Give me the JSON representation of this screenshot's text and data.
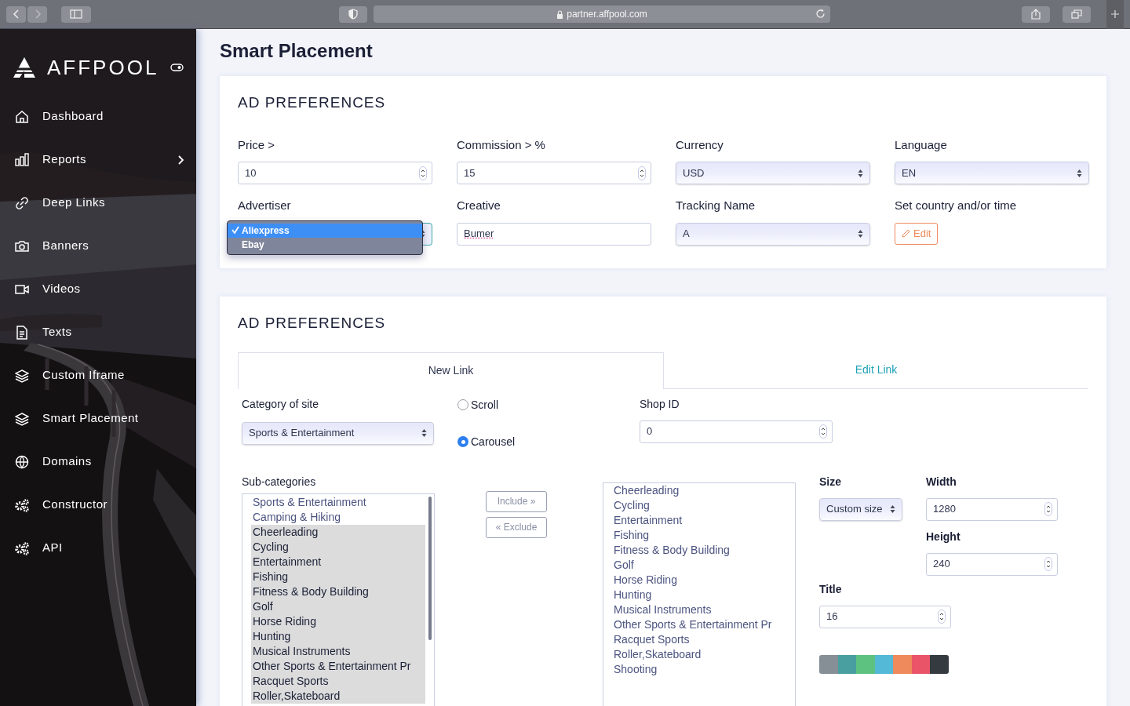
{
  "browser": {
    "url": "partner.affpool.com"
  },
  "sidebar": {
    "logo": "AFFPOOL",
    "items": [
      {
        "label": "Dashboard",
        "expandable": false
      },
      {
        "label": "Reports",
        "expandable": true
      },
      {
        "label": "Deep Links",
        "expandable": false
      },
      {
        "label": "Banners",
        "expandable": false
      },
      {
        "label": "Videos",
        "expandable": false
      },
      {
        "label": "Texts",
        "expandable": false
      },
      {
        "label": "Custom Iframe",
        "expandable": false
      },
      {
        "label": "Smart Placement",
        "expandable": false
      },
      {
        "label": "Domains",
        "expandable": false
      },
      {
        "label": "Constructor",
        "expandable": false
      },
      {
        "label": "API",
        "expandable": false
      }
    ]
  },
  "page_title": "Smart Placement",
  "ad_preferences": {
    "title": "AD PREFERENCES",
    "fields": [
      {
        "label": "Price >",
        "kind": "number",
        "value": "10"
      },
      {
        "label": "Commission > %",
        "kind": "number",
        "value": "15"
      },
      {
        "label": "Currency",
        "kind": "select",
        "value": "USD"
      },
      {
        "label": "Language",
        "kind": "select",
        "value": "EN"
      },
      {
        "label": "Advertiser",
        "kind": "dropdown",
        "options": [
          {
            "label": "Aliexpress",
            "selected": true
          },
          {
            "label": "Ebay",
            "selected": false
          }
        ]
      },
      {
        "label": "Creative",
        "kind": "text",
        "value": "Bumer"
      },
      {
        "label": "Tracking Name",
        "kind": "select",
        "value": "A"
      },
      {
        "label": "Set country and/or time",
        "kind": "button",
        "value": "Edit"
      }
    ]
  },
  "link_preferences": {
    "title": "AD PREFERENCES",
    "tabs": [
      {
        "label": "New Link",
        "selected": true
      },
      {
        "label": "Edit Link",
        "selected": false
      }
    ],
    "category": {
      "label": "Category of site",
      "value": "Sports & Entertainment"
    },
    "display": [
      {
        "label": "Scroll",
        "selected": false
      },
      {
        "label": "Carousel",
        "selected": true
      }
    ],
    "shop_id": {
      "label": "Shop ID",
      "value": "0"
    },
    "subcategories": {
      "label": "Sub-categories",
      "items": [
        {
          "label": "Sports & Entertainment",
          "selected": false
        },
        {
          "label": "Camping & Hiking",
          "selected": false
        },
        {
          "label": "Cheerleading",
          "selected": true
        },
        {
          "label": "Cycling",
          "selected": true
        },
        {
          "label": "Entertainment",
          "selected": true
        },
        {
          "label": "Fishing",
          "selected": true
        },
        {
          "label": "Fitness & Body Building",
          "selected": true
        },
        {
          "label": "Golf",
          "selected": true
        },
        {
          "label": "Horse Riding",
          "selected": true
        },
        {
          "label": "Hunting",
          "selected": true
        },
        {
          "label": "Musical Instruments",
          "selected": true
        },
        {
          "label": "Other Sports & Entertainment Pr",
          "selected": true
        },
        {
          "label": "Racquet Sports",
          "selected": true
        },
        {
          "label": "Roller,Skateboard",
          "selected": true
        }
      ]
    },
    "include_button": "Include »",
    "exclude_button": "« Exclude",
    "included": [
      "Cheerleading",
      "Cycling",
      "Entertainment",
      "Fishing",
      "Fitness & Body Building",
      "Golf",
      "Horse Riding",
      "Hunting",
      "Musical Instruments",
      "Other Sports & Entertainment Pr",
      "Racquet Sports",
      "Roller,Skateboard",
      "Shooting"
    ],
    "size": {
      "label": "Size",
      "value": "Custom size"
    },
    "width": {
      "label": "Width",
      "value": "1280"
    },
    "height": {
      "label": "Height",
      "value": "240"
    },
    "title_field": {
      "label": "Title",
      "value": "16"
    },
    "swatches": [
      {
        "color": "#868e96"
      },
      {
        "color": "#499ea0"
      },
      {
        "color": "#5dc17f"
      },
      {
        "color": "#53b9d6"
      },
      {
        "color": "#ee8a5b"
      },
      {
        "color": "#e95468"
      },
      {
        "color": "#343a40"
      }
    ]
  }
}
